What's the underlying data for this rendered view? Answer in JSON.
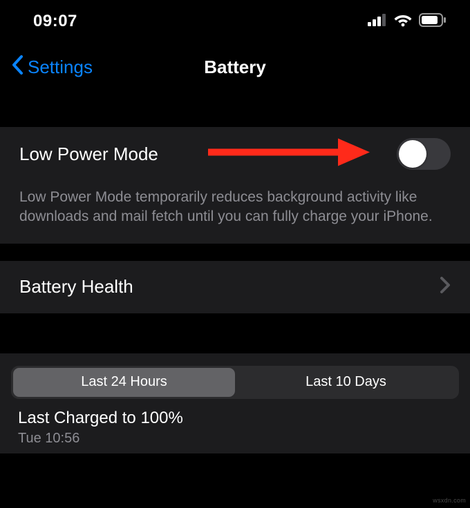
{
  "status": {
    "time": "09:07"
  },
  "nav": {
    "back_label": "Settings",
    "title": "Battery"
  },
  "low_power_mode": {
    "label": "Low Power Mode",
    "description": "Low Power Mode temporarily reduces background activity like downloads and mail fetch until you can fully charge your iPhone."
  },
  "battery_health": {
    "label": "Battery Health"
  },
  "segmented": {
    "tab1": "Last 24 Hours",
    "tab2": "Last 10 Days"
  },
  "last_charged": {
    "title": "Last Charged to 100%",
    "subtitle": "Tue 10:56"
  },
  "watermark": "wsxdn.com"
}
